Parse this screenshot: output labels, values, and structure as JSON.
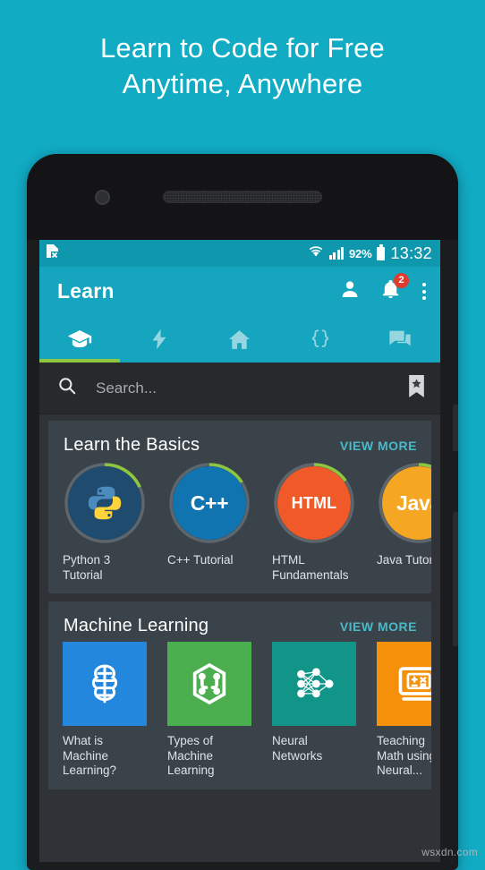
{
  "headline": {
    "line1": "Learn to Code for Free",
    "line2": "Anytime, Anywhere"
  },
  "colors": {
    "background_teal": "#11abc4",
    "appbar_teal": "#15a5be",
    "statusbar_teal": "#0f97ad",
    "card_dark": "#3a434a",
    "screen_dark": "#2f3337",
    "search_dark": "#27292c",
    "accent_green": "#8dc63f",
    "link_teal": "#49b9c9",
    "badge_red": "#e23b2e"
  },
  "statusbar": {
    "sim_icon": "sim-card-error-icon",
    "wifi_icon": "wifi-icon",
    "signal_icon": "signal-bars-icon",
    "battery_percent": "92%",
    "battery_icon": "battery-full-icon",
    "clock": "13:32"
  },
  "appbar": {
    "title": "Learn",
    "account_icon": "person-icon",
    "notifications_icon": "bell-icon",
    "notifications_badge": "2",
    "overflow_icon": "overflow-menu-icon"
  },
  "tabs": [
    {
      "name": "tab-learn",
      "icon": "graduation-cap-icon",
      "active": true
    },
    {
      "name": "tab-challenges",
      "icon": "lightning-bolt-icon",
      "active": false
    },
    {
      "name": "tab-home",
      "icon": "home-icon",
      "active": false
    },
    {
      "name": "tab-code",
      "icon": "code-braces-icon",
      "active": false
    },
    {
      "name": "tab-discuss",
      "icon": "chat-bubbles-icon",
      "active": false
    }
  ],
  "search": {
    "icon": "search-icon",
    "placeholder": "Search...",
    "bookmark_icon": "bookmark-star-icon"
  },
  "sections": [
    {
      "title": "Learn the Basics",
      "view_more": "VIEW MORE",
      "items": [
        {
          "label": "Python 3\nTutorial",
          "badge": "",
          "icon": "python-logo-icon",
          "circle_color": "#1f4b6e",
          "progress": 18
        },
        {
          "label": "C++ Tutorial",
          "badge": "C++",
          "icon": "cpp-text-icon",
          "circle_color": "#1074b0",
          "progress": 16
        },
        {
          "label": "HTML\nFundamentals",
          "badge": "HTML",
          "icon": "html-text-icon",
          "circle_color": "#f05a28",
          "progress": 15
        },
        {
          "label": "Java Tutor",
          "badge": "Java",
          "icon": "java-text-icon",
          "circle_color": "#f5a623",
          "progress": 8
        }
      ]
    },
    {
      "title": "Machine Learning",
      "view_more": "VIEW MORE",
      "items": [
        {
          "label": "What is\nMachine\nLearning?",
          "icon": "brain-circuit-icon",
          "tile_color": "#2388dd"
        },
        {
          "label": "Types of\nMachine\nLearning",
          "icon": "hexagon-nodes-icon",
          "tile_color": "#4caf4f"
        },
        {
          "label": "Neural\nNetworks",
          "icon": "neural-network-icon",
          "tile_color": "#119588"
        },
        {
          "label": "Teaching\nMath using\nNeural...",
          "icon": "computer-calculator-icon",
          "tile_color": "#f5900a"
        }
      ]
    }
  ],
  "watermark": "wsxdn.com"
}
